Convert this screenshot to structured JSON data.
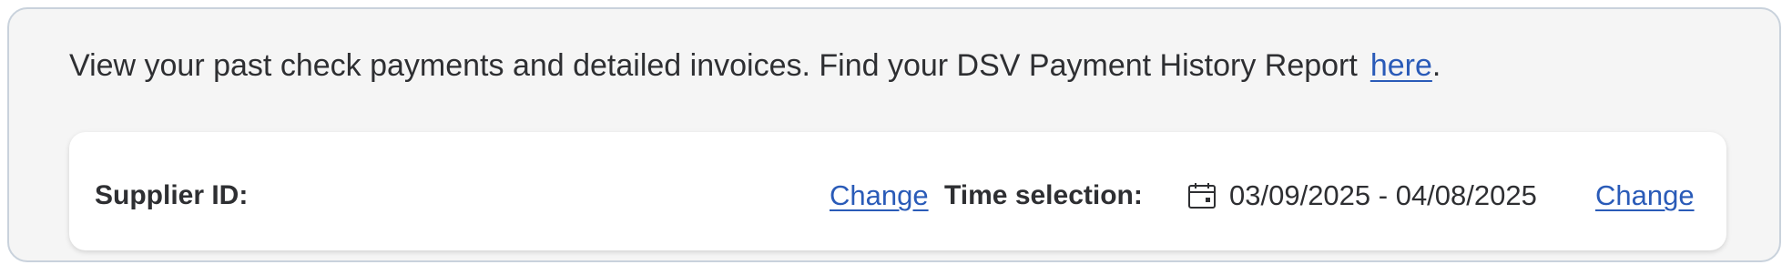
{
  "intro": {
    "text": "View your past check payments and detailed invoices. Find your DSV Payment History Report",
    "link_label": "here",
    "trailing": "."
  },
  "filters": {
    "supplier_id_label": "Supplier ID:",
    "supplier_change_label": "Change",
    "time_selection_label": "Time selection:",
    "date_range": "03/09/2025 - 04/08/2025",
    "time_change_label": "Change",
    "calendar_icon": "calendar-icon"
  },
  "colors": {
    "link": "#2a5bb8",
    "panel_bg": "#f5f5f5",
    "card_bg": "#ffffff",
    "border": "#c9d2dc",
    "text": "#2e2f32"
  }
}
